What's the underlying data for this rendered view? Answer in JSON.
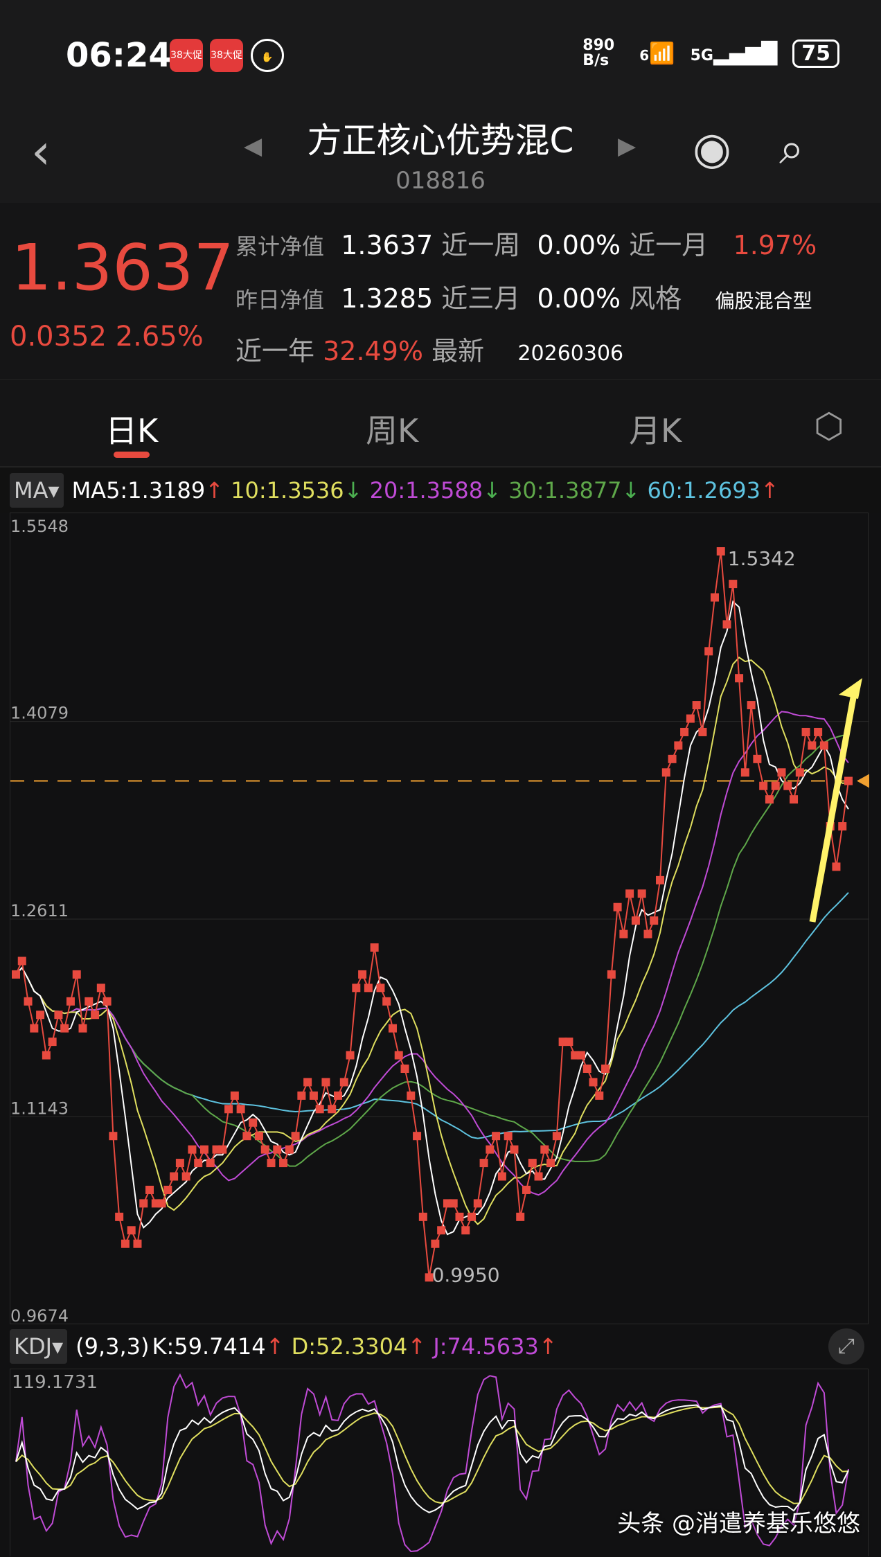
{
  "status_bar": {
    "time": "06:24",
    "app_badge": "38大促",
    "net_speed": "890 B/s",
    "wifi": "6",
    "signal": "5G",
    "battery": "75"
  },
  "header": {
    "title": "方正核心优势混C",
    "code": "018816"
  },
  "summary": {
    "nav": "1.3637",
    "change": "0.0352",
    "change_pct": "2.65%",
    "rows": [
      {
        "label": "累计净值",
        "value": "1.3637",
        "l2": "近一周",
        "v2": "0.00%",
        "l3": "近一月",
        "v3": "1.97%"
      },
      {
        "label": "昨日净值",
        "value": "1.3285",
        "l2": "近三月",
        "v2": "0.00%",
        "l3": "风格",
        "v3": "偏股混合型"
      },
      {
        "label": "近一年",
        "value": "32.49%",
        "l2": "最新",
        "v2": "20260306"
      }
    ]
  },
  "tabs": [
    "日K",
    "周K",
    "月K"
  ],
  "ma": {
    "selector": "MA",
    "items": [
      {
        "text": "MA5:1.3189",
        "arrow": "↑",
        "color": "#ffffff",
        "arrow_color": "#e84a3f"
      },
      {
        "text": "10:1.3536",
        "arrow": "↓",
        "color": "#e0df5f",
        "arrow_color": "#4caf50"
      },
      {
        "text": "20:1.3588",
        "arrow": "↓",
        "color": "#c04bd6",
        "arrow_color": "#4caf50"
      },
      {
        "text": "30:1.3877",
        "arrow": "↓",
        "color": "#5fa84a",
        "arrow_color": "#4caf50"
      },
      {
        "text": "60:1.2693",
        "arrow": "↑",
        "color": "#5ec3e0",
        "arrow_color": "#e84a3f"
      }
    ]
  },
  "kdj": {
    "selector": "KDJ",
    "params": "(9,3,3)",
    "items": [
      {
        "text": "K:59.7414",
        "arrow": "↑",
        "color": "#ffffff"
      },
      {
        "text": "D:52.3304",
        "arrow": "↑",
        "color": "#e0df5f"
      },
      {
        "text": "J:74.5633",
        "arrow": "↑",
        "color": "#c04bd6"
      }
    ],
    "top_label": "119.1731"
  },
  "watermark": "头条 @消遣养基乐悠悠",
  "chart_data": {
    "type": "line",
    "title": "日K",
    "ylim": [
      0.9674,
      1.5548
    ],
    "yticks": [
      "1.5548",
      "1.4079",
      "1.2611",
      "1.1143",
      "0.9674"
    ],
    "max_label": "1.5342",
    "min_label": "0.9950",
    "current": 1.3637,
    "closes": [
      1.22,
      1.23,
      1.2,
      1.18,
      1.19,
      1.16,
      1.17,
      1.19,
      1.18,
      1.2,
      1.22,
      1.18,
      1.2,
      1.19,
      1.21,
      1.2,
      1.1,
      1.04,
      1.02,
      1.03,
      1.02,
      1.05,
      1.06,
      1.05,
      1.05,
      1.06,
      1.07,
      1.08,
      1.07,
      1.09,
      1.08,
      1.09,
      1.08,
      1.09,
      1.09,
      1.12,
      1.13,
      1.12,
      1.1,
      1.11,
      1.1,
      1.09,
      1.08,
      1.09,
      1.08,
      1.09,
      1.1,
      1.13,
      1.14,
      1.13,
      1.12,
      1.14,
      1.12,
      1.13,
      1.14,
      1.16,
      1.21,
      1.22,
      1.21,
      1.24,
      1.21,
      1.2,
      1.18,
      1.16,
      1.15,
      1.13,
      1.1,
      1.04,
      0.995,
      1.02,
      1.03,
      1.05,
      1.05,
      1.04,
      1.03,
      1.04,
      1.05,
      1.08,
      1.09,
      1.1,
      1.07,
      1.1,
      1.09,
      1.04,
      1.06,
      1.08,
      1.07,
      1.09,
      1.08,
      1.1,
      1.17,
      1.17,
      1.16,
      1.16,
      1.15,
      1.14,
      1.13,
      1.15,
      1.22,
      1.27,
      1.25,
      1.28,
      1.26,
      1.28,
      1.25,
      1.26,
      1.29,
      1.37,
      1.38,
      1.39,
      1.4,
      1.41,
      1.42,
      1.4,
      1.46,
      1.5,
      1.5342,
      1.48,
      1.51,
      1.44,
      1.37,
      1.42,
      1.38,
      1.36,
      1.35,
      1.36,
      1.37,
      1.36,
      1.35,
      1.37,
      1.4,
      1.39,
      1.4,
      1.39,
      1.33,
      1.3,
      1.33,
      1.3637
    ]
  }
}
